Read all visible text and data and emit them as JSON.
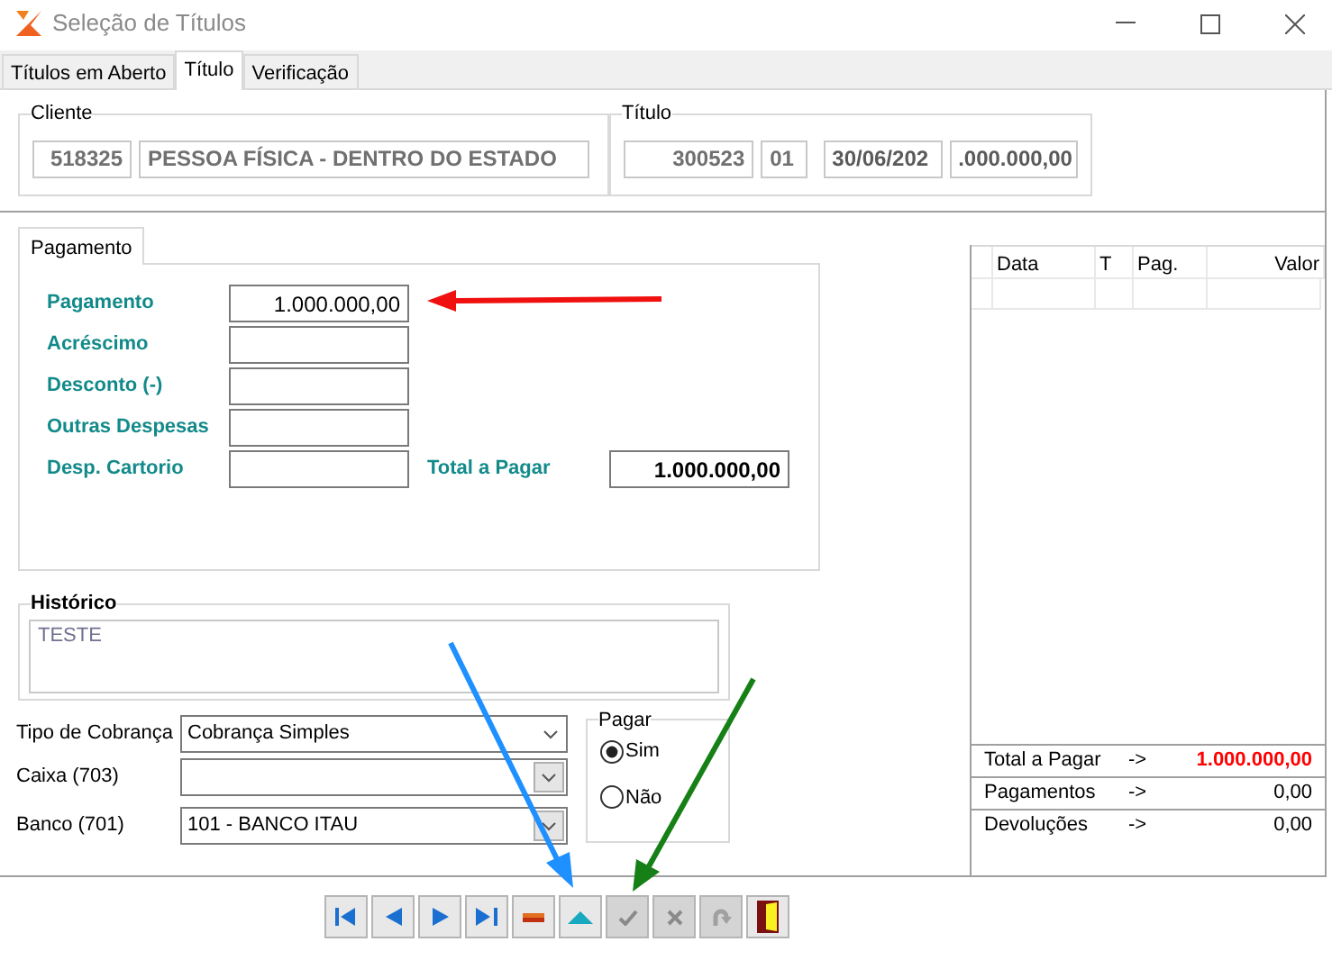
{
  "window": {
    "title": "Seleção de Títulos"
  },
  "tabs": [
    {
      "label": "Títulos em Aberto",
      "selected": false
    },
    {
      "label": "Título",
      "selected": true
    },
    {
      "label": "Verificação",
      "selected": false
    }
  ],
  "cliente": {
    "legend": "Cliente",
    "code": "518325",
    "name": "PESSOA FÍSICA - DENTRO DO ESTADO"
  },
  "titulo": {
    "legend": "Título",
    "number": "300523",
    "parcel": "01",
    "date": "30/06/202",
    "value": ".000.000,00"
  },
  "payment": {
    "tab": "Pagamento",
    "fields": [
      {
        "label": "Pagamento",
        "value": "1.000.000,00"
      },
      {
        "label": "Acréscimo"
      },
      {
        "label": "Desconto (-)"
      },
      {
        "label": "Outras Despesas"
      },
      {
        "label": "Desp. Cartorio"
      }
    ],
    "total": {
      "label": "Total a Pagar",
      "value": "1.000.000,00"
    }
  },
  "historico": {
    "legend": "Histórico",
    "value": "TESTE"
  },
  "selects": [
    {
      "label": "Tipo de Cobrança",
      "value": "Cobrança Simples",
      "kind": "plain"
    },
    {
      "label": "Caixa (703)",
      "kind": "boxed"
    },
    {
      "label": "Banco (701)",
      "value": "101 - BANCO ITAU",
      "kind": "boxed"
    }
  ],
  "pagar": {
    "legend": "Pagar",
    "options": [
      {
        "label": "Sim",
        "selected": true
      },
      {
        "label": "Não",
        "selected": false
      }
    ]
  },
  "table": {
    "columns": [
      "Data",
      "T",
      "Pag.",
      "Valor"
    ]
  },
  "summary": [
    {
      "label": "Total a Pagar",
      "arrow": "->",
      "value": "1.000.000,00",
      "highlight": true
    },
    {
      "label": "Pagamentos",
      "arrow": "->",
      "value": "0,00",
      "highlight": false
    },
    {
      "label": "Devoluções",
      "arrow": "->",
      "value": "0,00",
      "highlight": false
    }
  ],
  "toolbar": [
    {
      "kind": "first",
      "disabled": false
    },
    {
      "kind": "prev",
      "disabled": false
    },
    {
      "kind": "next",
      "disabled": false
    },
    {
      "kind": "last",
      "disabled": false
    },
    {
      "kind": "delete",
      "disabled": false
    },
    {
      "kind": "insert",
      "disabled": false
    },
    {
      "kind": "confirm",
      "disabled": true
    },
    {
      "kind": "cancel",
      "disabled": true
    },
    {
      "kind": "refresh",
      "disabled": true
    },
    {
      "kind": "exit",
      "disabled": false
    }
  ]
}
